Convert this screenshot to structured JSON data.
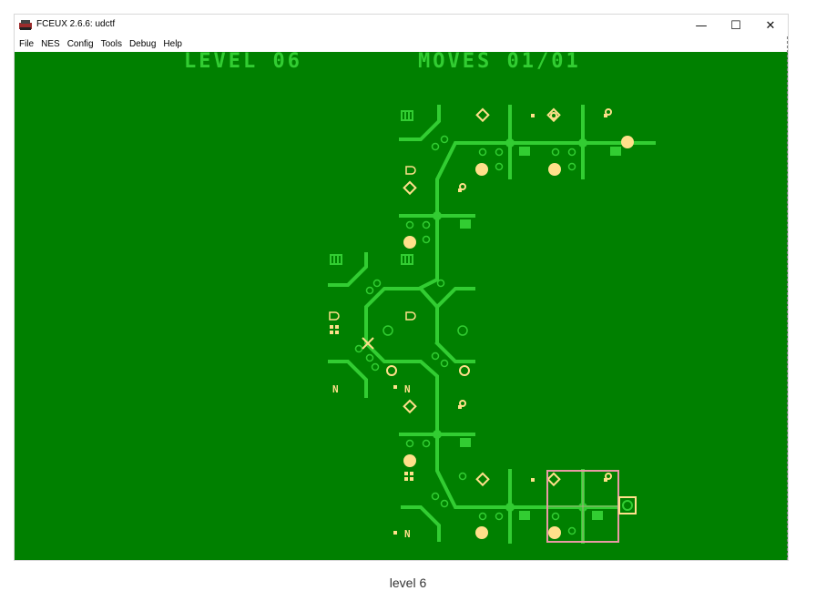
{
  "window": {
    "title": "FCEUX 2.6.6: udctf",
    "controls": {
      "minimize": "—",
      "maximize": "☐",
      "close": "✕"
    }
  },
  "menu": [
    "File",
    "NES",
    "Config",
    "Tools",
    "Debug",
    "Help"
  ],
  "game": {
    "level_label": "LEVEL 06",
    "moves_label": "MOVES 01/01",
    "colors": {
      "background": "#008000",
      "track": "#32cd32",
      "accent": "#ffe08a",
      "cursor": "#e89aa4"
    }
  },
  "caption": "level 6"
}
